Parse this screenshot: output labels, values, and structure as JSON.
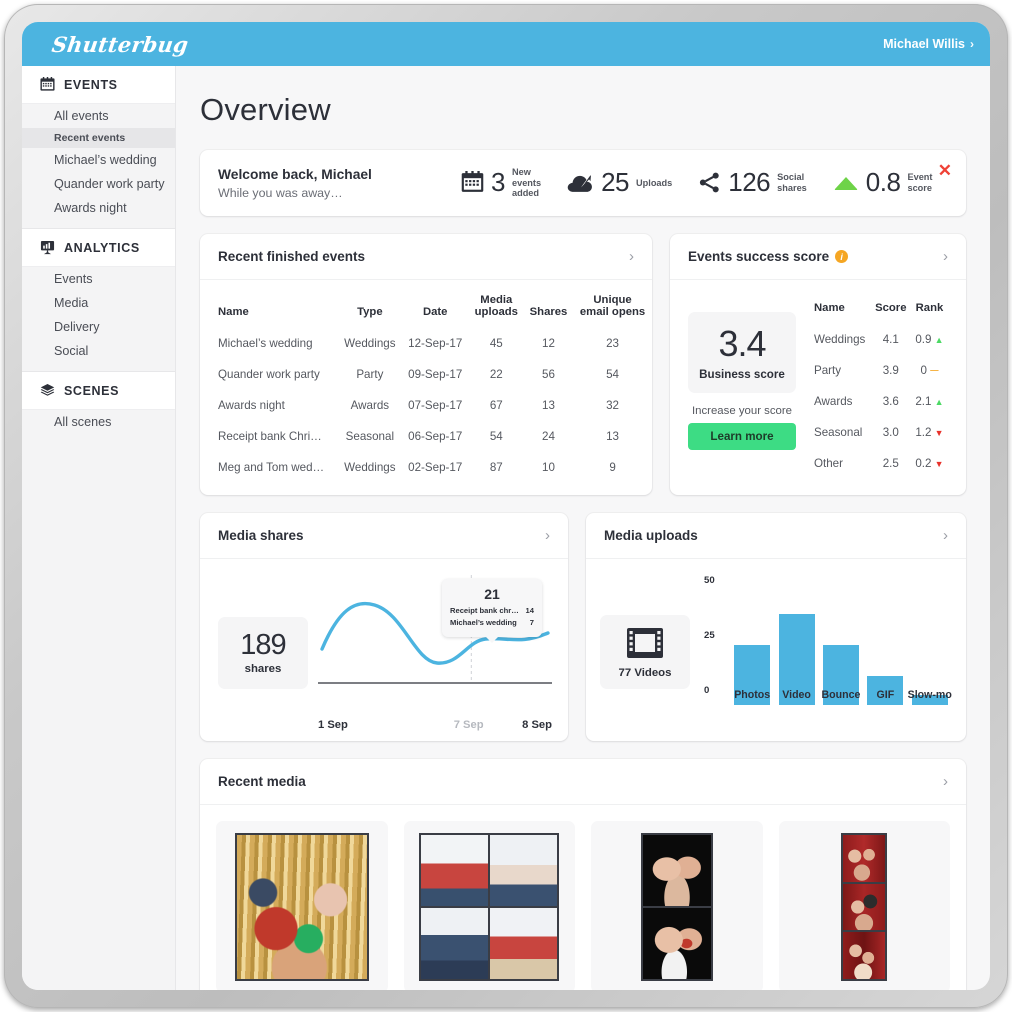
{
  "brand": "Shutterbug",
  "header": {
    "user": "Michael Willis",
    "chevron": "›"
  },
  "sidebar": {
    "groups": [
      {
        "label": "EVENTS",
        "icon": "calendar-icon",
        "items": [
          {
            "label": "All events",
            "active": false
          },
          {
            "label": "Recent events",
            "active": true
          },
          {
            "label": "Michael’s wedding",
            "active": false
          },
          {
            "label": "Quander work party",
            "active": false
          },
          {
            "label": "Awards night",
            "active": false
          }
        ]
      },
      {
        "label": "ANALYTICS",
        "icon": "chart-presentation-icon",
        "items": [
          {
            "label": "Events",
            "active": false
          },
          {
            "label": "Media",
            "active": false
          },
          {
            "label": "Delivery",
            "active": false
          },
          {
            "label": "Social",
            "active": false
          }
        ]
      },
      {
        "label": "SCENES",
        "icon": "layers-icon",
        "items": [
          {
            "label": "All scenes",
            "active": false
          }
        ]
      }
    ]
  },
  "page": {
    "title": "Overview"
  },
  "welcome": {
    "title": "Welcome back, Michael",
    "subtitle": "While you was away…",
    "close": "✕",
    "stats": [
      {
        "icon": "calendar-icon",
        "value": "3",
        "label_line1": "New",
        "label_line2": "events",
        "label_line3": "added"
      },
      {
        "icon": "cloud-upload-icon",
        "value": "25",
        "label_line1": "Uploads",
        "label_line2": "",
        "label_line3": ""
      },
      {
        "icon": "share-nodes-icon",
        "value": "126",
        "label_line1": "Social",
        "label_line2": "shares",
        "label_line3": ""
      },
      {
        "icon": "triangle-up-icon",
        "value": "0.8",
        "label_line1": "Event",
        "label_line2": "score",
        "label_line3": ""
      }
    ]
  },
  "recent_events": {
    "title": "Recent finished events",
    "chevron": "›",
    "columns": [
      "Name",
      "Type",
      "Date",
      "Media uploads",
      "Shares",
      "Unique email opens"
    ],
    "columns_wrapped": [
      {
        "l1": "Name",
        "l2": ""
      },
      {
        "l1": "Type",
        "l2": ""
      },
      {
        "l1": "Date",
        "l2": ""
      },
      {
        "l1": "Media",
        "l2": "uploads"
      },
      {
        "l1": "Shares",
        "l2": ""
      },
      {
        "l1": "Unique",
        "l2": "email opens"
      }
    ],
    "rows": [
      {
        "name": "Michael’s wedding",
        "type": "Weddings",
        "date": "12-Sep-17",
        "uploads": "45",
        "shares": "12",
        "opens": "23"
      },
      {
        "name": "Quander work party",
        "type": "Party",
        "date": "09-Sep-17",
        "uploads": "22",
        "shares": "56",
        "opens": "54"
      },
      {
        "name": "Awards night",
        "type": "Awards",
        "date": "07-Sep-17",
        "uploads": "67",
        "shares": "13",
        "opens": "32"
      },
      {
        "name": "Receipt bank Chri…",
        "type": "Seasonal",
        "date": "06-Sep-17",
        "uploads": "54",
        "shares": "24",
        "opens": "13"
      },
      {
        "name": "Meg and Tom wed…",
        "type": "Weddings",
        "date": "02-Sep-17",
        "uploads": "87",
        "shares": "10",
        "opens": "9"
      }
    ]
  },
  "success_score": {
    "title": "Events success score",
    "info_icon": "info-icon",
    "chevron": "›",
    "business_score": "3.4",
    "business_score_caption": "Business score",
    "increase_text": "Increase your score",
    "learn_more": "Learn more",
    "columns": [
      "Name",
      "Score",
      "Rank"
    ],
    "rows": [
      {
        "name": "Weddings",
        "score": "4.1",
        "rank": "0.9",
        "dir": "up"
      },
      {
        "name": "Party",
        "score": "3.9",
        "rank": "0",
        "dir": "flat"
      },
      {
        "name": "Awards",
        "score": "3.6",
        "rank": "2.1",
        "dir": "up"
      },
      {
        "name": "Seasonal",
        "score": "3.0",
        "rank": "1.2",
        "dir": "down"
      },
      {
        "name": "Other",
        "score": "2.5",
        "rank": "0.2",
        "dir": "down"
      }
    ]
  },
  "media_shares": {
    "title": "Media shares",
    "chevron": "›",
    "total": "189",
    "total_caption": "shares",
    "axis": {
      "start": "1 Sep",
      "mid": "7 Sep",
      "end": "8 Sep"
    },
    "tooltip": {
      "value": "21",
      "rows": [
        {
          "label": "Receipt bank chr…",
          "value": "14"
        },
        {
          "label": "Michael’s wedding",
          "value": "7"
        }
      ]
    }
  },
  "media_uploads": {
    "title": "Media uploads",
    "chevron": "›",
    "videos_count": "77 Videos",
    "videos_icon": "film-strip-icon"
  },
  "recent_media": {
    "title": "Recent media",
    "chevron": "›",
    "tiles": [
      {
        "name": "photo-strip-gold-confetti",
        "layout": "single"
      },
      {
        "name": "photo-grid-bunting",
        "layout": "quad"
      },
      {
        "name": "photo-strip-black-couple",
        "layout": "duo"
      },
      {
        "name": "photo-strip-red-curtain",
        "layout": "trio"
      }
    ]
  },
  "colors": {
    "brand_blue": "#4cb4e0",
    "green": "#3ddc84",
    "red": "#e8312a",
    "amber": "#f5a623",
    "ink": "#2d3039"
  },
  "chart_data": [
    {
      "type": "line",
      "title": "Media shares",
      "xlabel": "",
      "ylabel": "shares",
      "x": [
        "1 Sep",
        "2 Sep",
        "3 Sep",
        "4 Sep",
        "5 Sep",
        "6 Sep",
        "7 Sep",
        "8 Sep"
      ],
      "values": [
        12,
        27,
        24,
        16,
        11,
        17,
        21,
        22
      ],
      "total": 189,
      "annotation": {
        "x": "7 Sep",
        "value": 21,
        "breakdown": [
          {
            "label": "Receipt bank chr…",
            "value": 14
          },
          {
            "label": "Michael’s wedding",
            "value": 7
          }
        ]
      },
      "ylim": [
        0,
        30
      ],
      "grid": false,
      "legend": "none"
    },
    {
      "type": "bar",
      "title": "Media uploads",
      "categories": [
        "Photos",
        "Video",
        "Bounce",
        "GIF",
        "Slow-mo"
      ],
      "values": [
        25,
        38,
        25,
        12,
        3
      ],
      "xlabel": "",
      "ylabel": "",
      "yticks": [
        0,
        25,
        50
      ],
      "ylim": [
        0,
        50
      ],
      "grid": false,
      "legend": "none"
    },
    {
      "type": "table",
      "title": "Events success score",
      "columns": [
        "Name",
        "Score",
        "Rank"
      ],
      "rows": [
        [
          "Weddings",
          4.1,
          0.9
        ],
        [
          "Party",
          3.9,
          0
        ],
        [
          "Awards",
          3.6,
          2.1
        ],
        [
          "Seasonal",
          3.0,
          1.2
        ],
        [
          "Other",
          2.5,
          0.2
        ]
      ]
    }
  ]
}
